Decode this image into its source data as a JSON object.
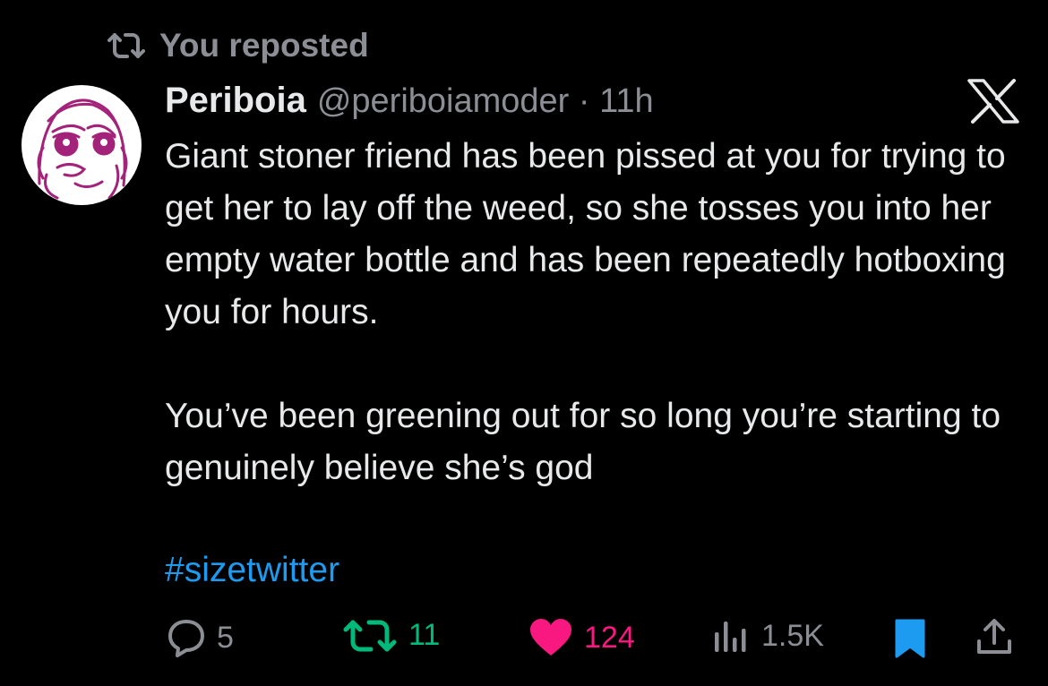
{
  "repost": {
    "label": "You reposted",
    "color": "#8b8f95"
  },
  "tweet": {
    "author_name": "Periboia",
    "handle_time": "@periboiamoder · 11h",
    "paragraph1": "Giant stoner friend has been pissed at you for trying to get her to lay off the weed, so she tosses you into her empty water bottle and has been repeatedly hotboxing you for hours.",
    "paragraph2": "You’ve been greening out for so long you’re starting to genuinely believe she’s god",
    "hashtag": "#sizetwitter"
  },
  "actions": {
    "replies": "5",
    "reposts": "11",
    "likes": "124",
    "views": "1.5K"
  },
  "colors": {
    "background": "#000000",
    "text": "#e7e9ea",
    "muted": "#8b8f95",
    "hashtag": "#1d9bf0",
    "repost_active": "#00ba7c",
    "like_active": "#f91880",
    "bookmark_active": "#1d9bf0",
    "avatar_ink": "#a3237a"
  },
  "icons": [
    "repost-icon",
    "avatar",
    "x-logo-icon",
    "reply-icon",
    "like-icon",
    "views-icon",
    "bookmark-icon",
    "share-icon"
  ]
}
